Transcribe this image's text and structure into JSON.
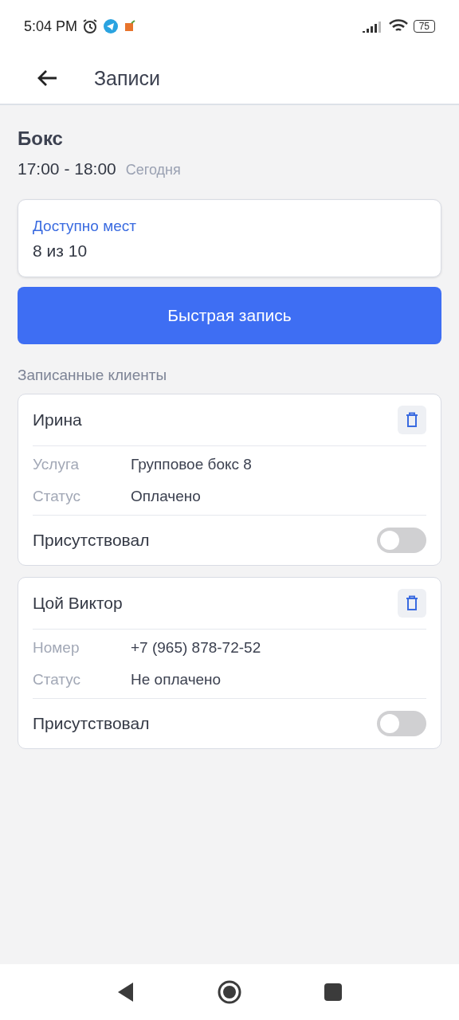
{
  "status_bar": {
    "time": "5:04 PM",
    "battery": "75"
  },
  "header": {
    "title": "Записи"
  },
  "session": {
    "title": "Бокс",
    "time": "17:00 - 18:00",
    "day": "Сегодня"
  },
  "availability": {
    "label": "Доступно мест",
    "value": "8 из 10"
  },
  "quick_button": "Быстрая запись",
  "clients_heading": "Записанные клиенты",
  "clients": [
    {
      "name": "Ирина",
      "fields": [
        {
          "label": "Услуга",
          "value": "Групповое бокс 8"
        },
        {
          "label": "Статус",
          "value": "Оплачено"
        }
      ],
      "attended_label": "Присутствовал",
      "attended": false
    },
    {
      "name": "Цой Виктор",
      "fields": [
        {
          "label": "Номер",
          "value": "+7 (965) 878-72-52"
        },
        {
          "label": "Статус",
          "value": "Не оплачено"
        }
      ],
      "attended_label": "Присутствовал",
      "attended": false
    }
  ]
}
